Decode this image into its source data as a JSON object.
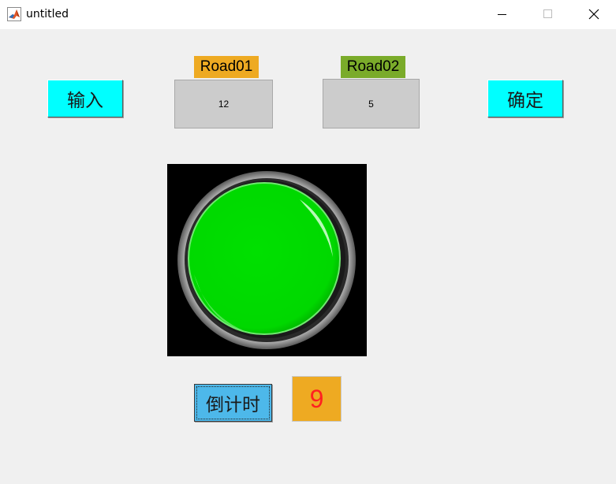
{
  "window": {
    "title": "untitled",
    "controls": [
      "minimize",
      "maximize",
      "close"
    ]
  },
  "icons": {
    "app": "matlab-icon",
    "minimize": "minimize-icon",
    "maximize": "maximize-icon",
    "close": "close-icon"
  },
  "buttons": {
    "input_label": "输入",
    "confirm_label": "确定",
    "countdown_label": "倒计时"
  },
  "roads": [
    {
      "label": "Road01",
      "value": "12",
      "tag_color": "#eeaa22"
    },
    {
      "label": "Road02",
      "value": "5",
      "tag_color": "#7aab2a"
    }
  ],
  "traffic_light": {
    "state": "green",
    "color": "#00dd00"
  },
  "countdown": {
    "value": "9",
    "text_color": "#ff2020",
    "background": "#eeaa22"
  },
  "colors": {
    "button_cyan": "#00ffff",
    "button_blue": "#4db8ea",
    "edit_gray": "#cccccc",
    "window_bg": "#f0f0f0"
  }
}
